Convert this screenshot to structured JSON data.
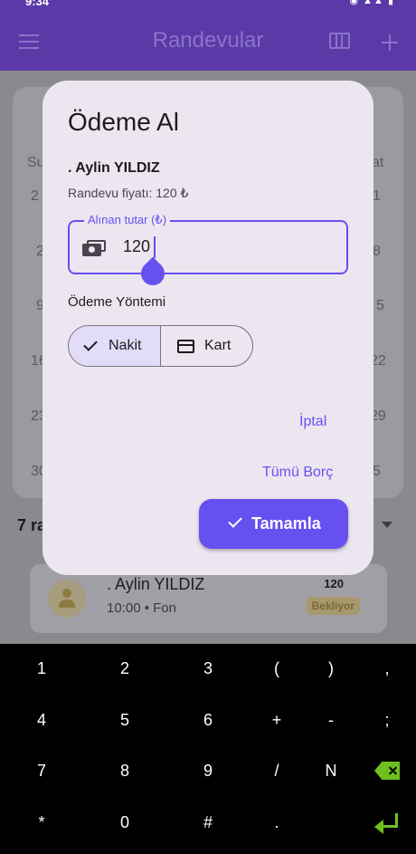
{
  "status_bar": {
    "time": "9:34",
    "right": "◉ ▲▲ ▮"
  },
  "app_bar": {
    "title": "Randevular"
  },
  "background": {
    "calendar_text": [
      "Su",
      "at",
      "2",
      "1",
      "2",
      "8",
      "9",
      "5",
      "16",
      "22",
      "23",
      "29",
      "30",
      "5"
    ],
    "appointments_count": "7 ra",
    "appointment": {
      "name": ". Aylin YILDIZ",
      "sub": "10:00 • Fon",
      "price": "120",
      "status": "Bekliyor"
    }
  },
  "dialog": {
    "title": "Ödeme Al",
    "client": ". Aylin YILDIZ",
    "price_text": "Randevu fiyatı: 120 ₺",
    "amount_label": "Alınan tutar (₺)",
    "amount_value": "120",
    "method_label": "Ödeme Yöntemi",
    "method_options": [
      "Nakit",
      "Kart"
    ],
    "selected_method": "Nakit",
    "cancel": "İptal",
    "all_debt": "Tümü Borç",
    "complete": "Tamamla"
  },
  "keyboard": {
    "row1": [
      "1",
      "2",
      "3",
      "(",
      ")",
      ","
    ],
    "row2": [
      "4",
      "5",
      "6",
      "+",
      "-",
      ";"
    ],
    "row3": [
      "7",
      "8",
      "9",
      "/",
      "N"
    ],
    "row4": [
      "*",
      "0",
      "#",
      "."
    ]
  }
}
